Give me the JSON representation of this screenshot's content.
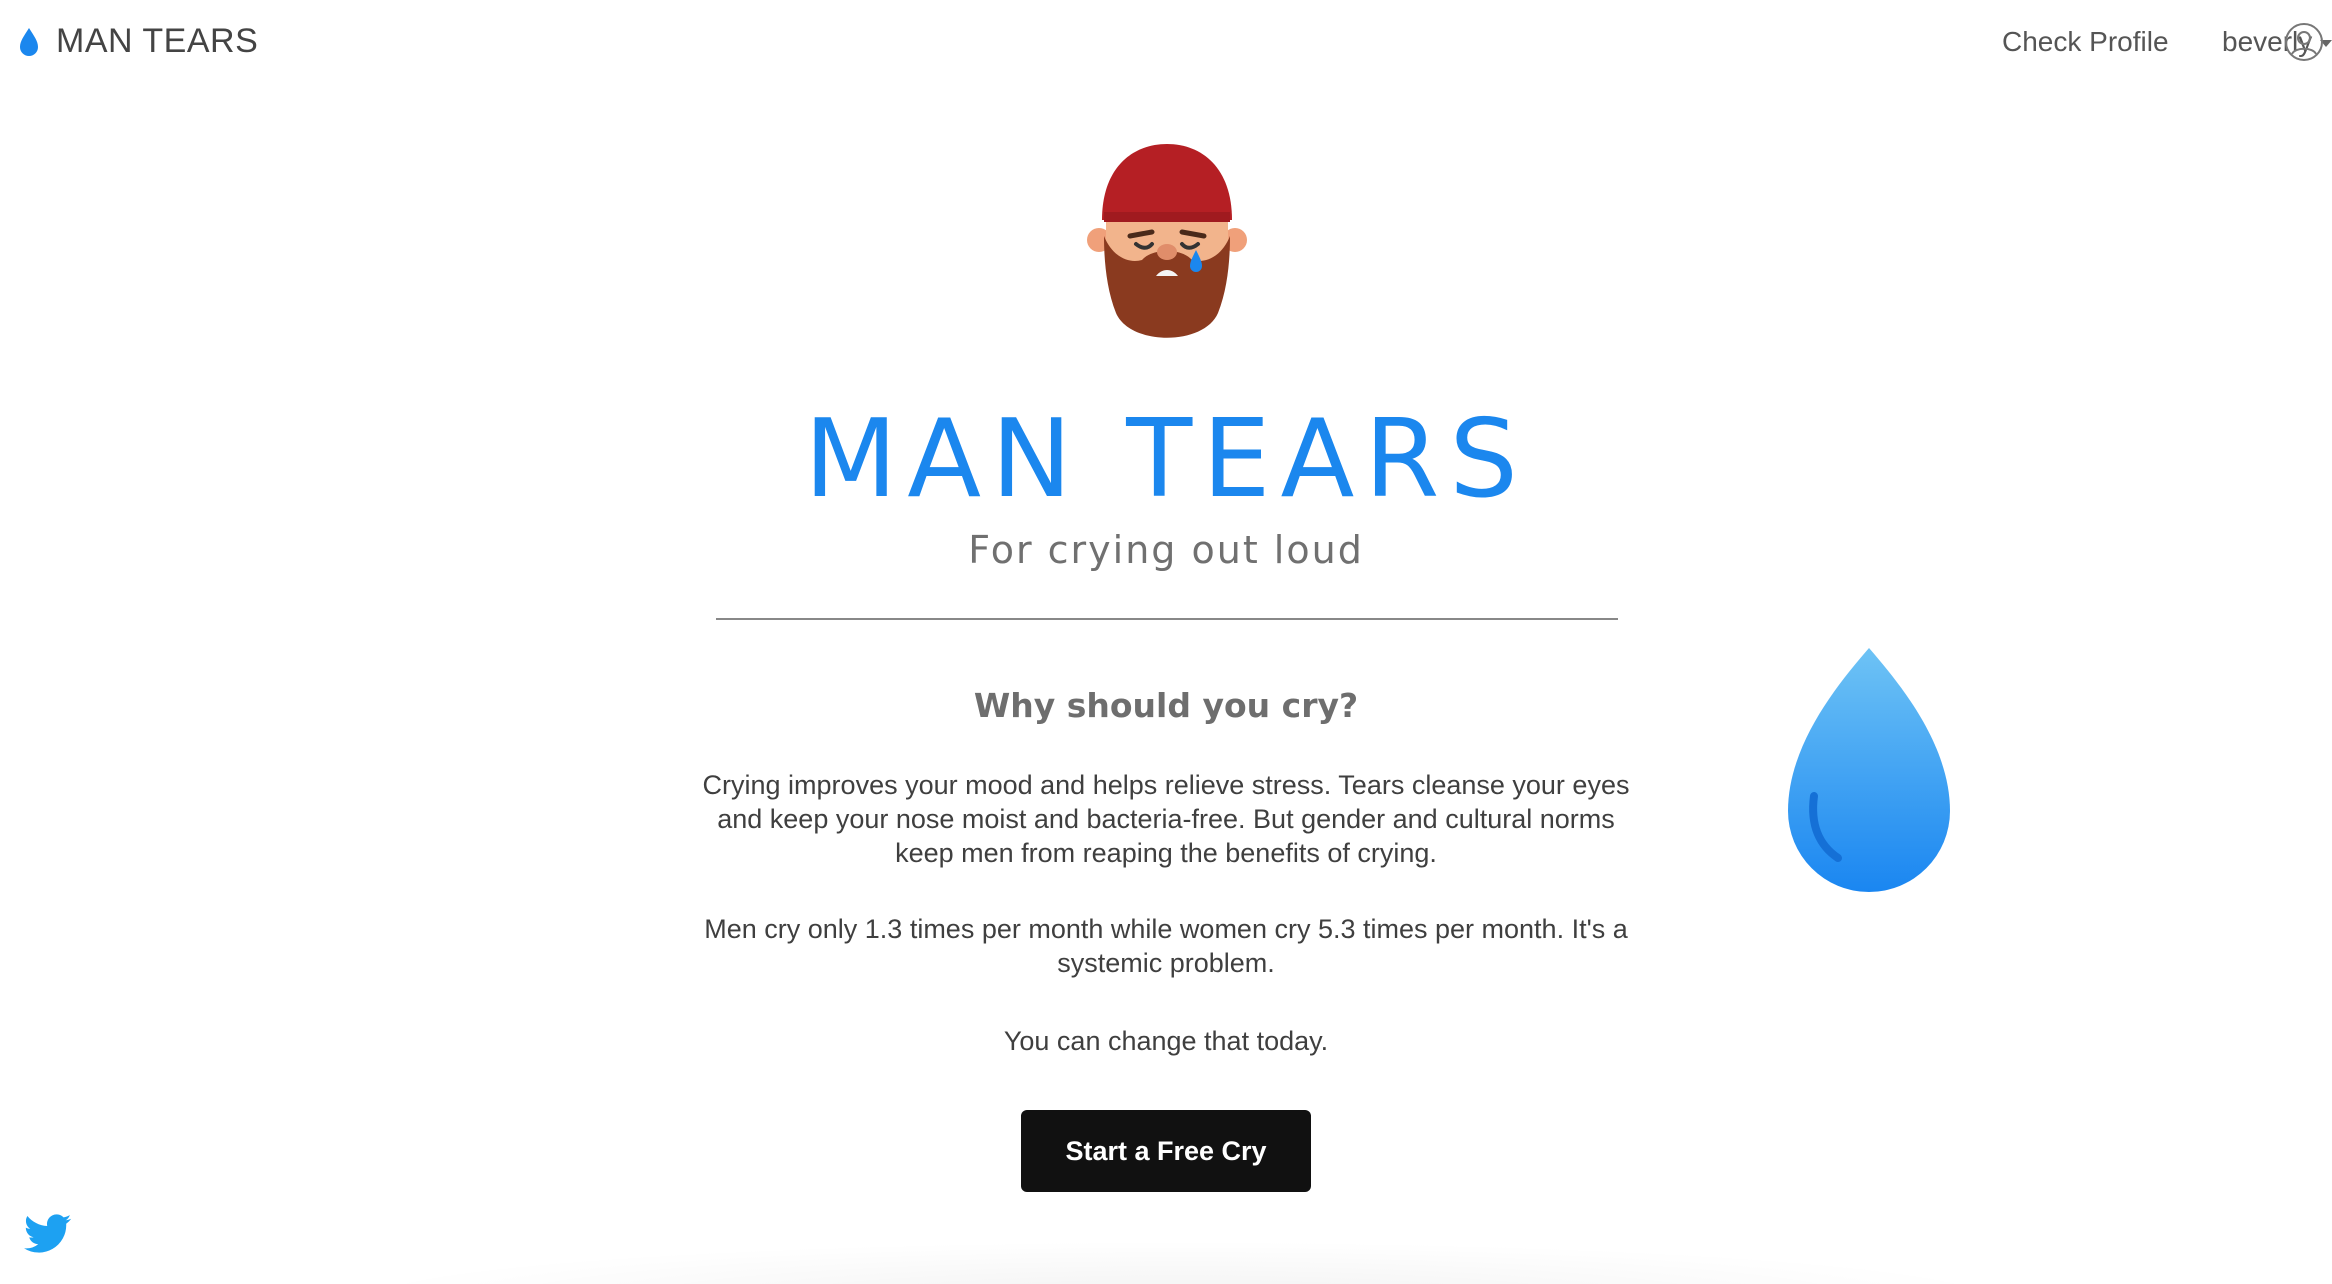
{
  "brand": {
    "name": "MAN TEARS",
    "icon": "water-drop-icon"
  },
  "nav": {
    "check_profile": "Check Profile",
    "username": "beverly",
    "avatar_icon": "user-circle-icon",
    "caret_icon": "caret-down-icon"
  },
  "hero": {
    "title": "MAN TEARS",
    "subtitle": "For crying out loud",
    "mascot_icon": "crying-bearded-man-icon"
  },
  "content": {
    "heading": "Why should you cry?",
    "paragraph_1": "Crying improves your mood and helps relieve stress. Tears cleanse your eyes and keep your nose moist and bacteria-free. But gender and cultural norms keep men from reaping the benefits of crying.",
    "paragraph_2": "Men cry only 1.3 times per month while women cry 5.3 times per month. It's a systemic problem.",
    "paragraph_3": "You can change that today.",
    "cta_label": "Start a Free Cry"
  },
  "decor": {
    "big_drop_icon": "large-tear-drop-icon",
    "twitter_icon": "twitter-icon"
  },
  "colors": {
    "accent": "#1b87ee",
    "button_bg": "#111111",
    "button_text": "#ffffff",
    "drop_light": "#6ec3f5",
    "drop_dark": "#1a86f1",
    "twitter": "#1da1f2"
  }
}
